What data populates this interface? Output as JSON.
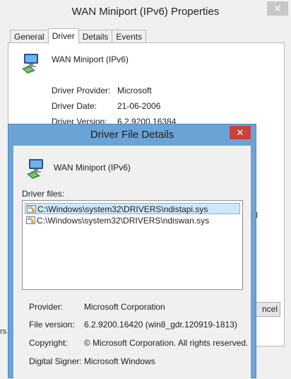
{
  "back_window": {
    "title": "WAN Miniport (IPv6) Properties",
    "close_glyph": "✕",
    "tabs": [
      {
        "label": "General",
        "active": false
      },
      {
        "label": "Driver",
        "active": true
      },
      {
        "label": "Details",
        "active": false
      },
      {
        "label": "Events",
        "active": false
      }
    ],
    "device_name": "WAN Miniport (IPv6)",
    "rows": [
      {
        "label": "Driver Provider:",
        "value": "Microsoft"
      },
      {
        "label": "Driver Date:",
        "value": "21-06-2006"
      },
      {
        "label": "Driver Version:",
        "value": "6.2.9200.16384"
      }
    ],
    "cancel_partial": "ncel",
    "sliver_text": "ll",
    "left_sliver": "rsa"
  },
  "dialog": {
    "title": "Driver File Details",
    "close_glyph": "✕",
    "device_name": "WAN Miniport (IPv6)",
    "files_label": "Driver files:",
    "files": [
      {
        "path": "C:\\Windows\\system32\\DRIVERS\\ndistapi.sys",
        "selected": true
      },
      {
        "path": "C:\\Windows\\system32\\DRIVERS\\ndiswan.sys",
        "selected": false
      }
    ],
    "details": [
      {
        "label": "Provider:",
        "value": "Microsoft Corporation"
      },
      {
        "label": "File version:",
        "value": "6.2.9200.16420 (win8_gdr.120919-1813)"
      },
      {
        "label": "Copyright:",
        "value": "© Microsoft Corporation. All rights reserved."
      },
      {
        "label": "Digital Signer:",
        "value": "Microsoft Windows"
      }
    ]
  },
  "icons": {
    "device": "network-adapter-icon",
    "file": "system-file-icon"
  },
  "colors": {
    "dialog_frame": "#6ba3d6",
    "close_button": "#c9423b",
    "selection": "#cde8fb"
  }
}
